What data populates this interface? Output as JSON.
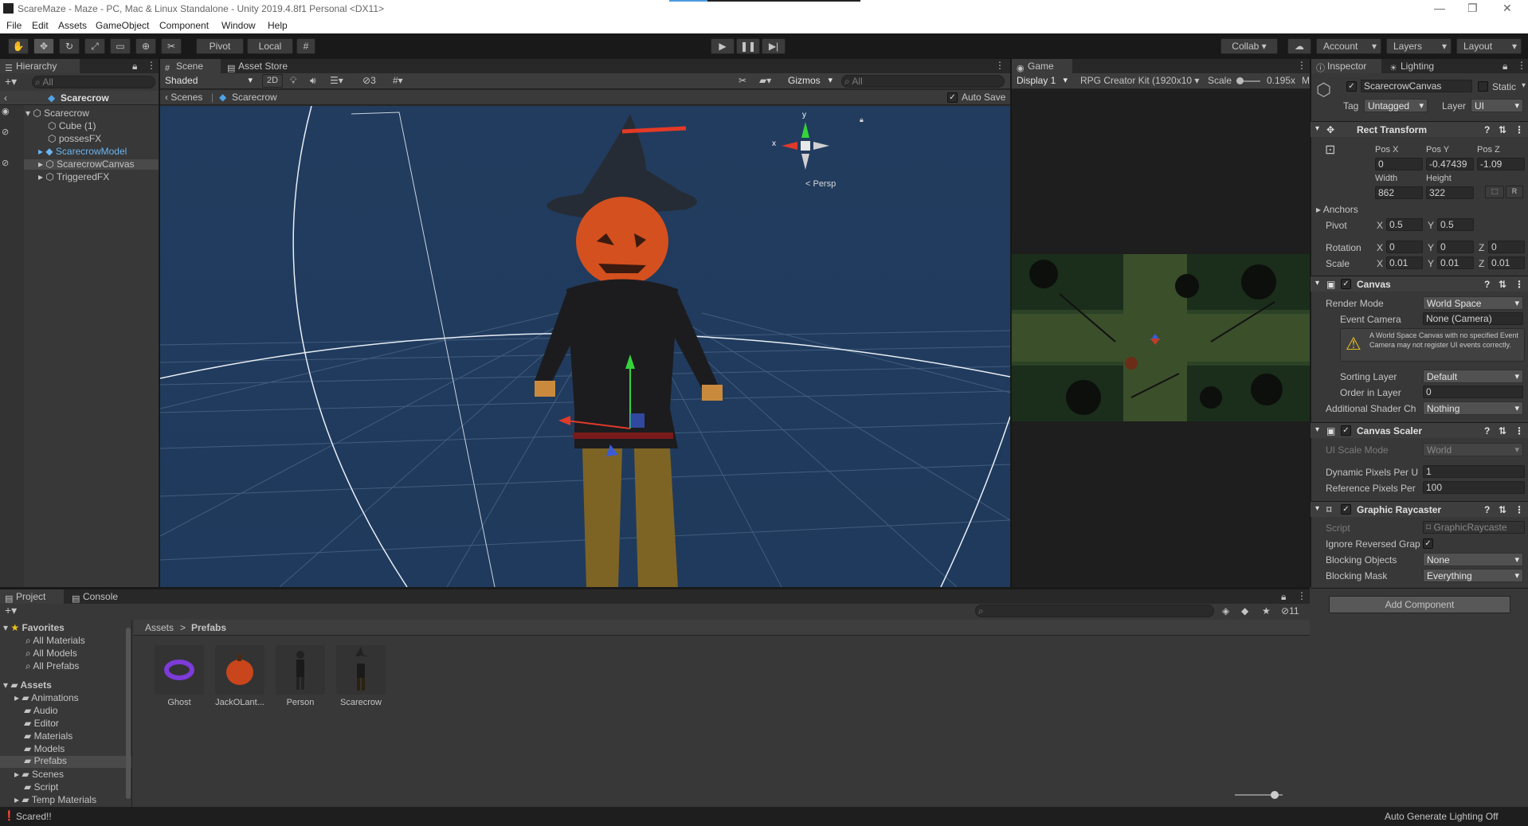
{
  "window": {
    "title": "ScareMaze - Maze - PC, Mac & Linux Standalone - Unity 2019.4.8f1 Personal <DX11>"
  },
  "menu": [
    "File",
    "Edit",
    "Assets",
    "GameObject",
    "Component",
    "Window",
    "Help"
  ],
  "toolbar": {
    "pivot": "Pivot",
    "local": "Local",
    "collab": "Collab ▾",
    "account": "Account",
    "layers": "Layers",
    "layout": "Layout"
  },
  "hierarchy": {
    "tab": "Hierarchy",
    "search_placeholder": "All",
    "scene": "Scarecrow",
    "items": [
      {
        "label": "Scarecrow",
        "selected": false
      },
      {
        "label": "Cube (1)",
        "selected": false
      },
      {
        "label": "possesFX",
        "selected": false
      },
      {
        "label": "ScarecrowModel",
        "selected": false
      },
      {
        "label": "ScarecrowCanvas",
        "selected": true
      },
      {
        "label": "TriggeredFX",
        "selected": false
      }
    ]
  },
  "scene": {
    "tabs": [
      "Scene",
      "Asset Store"
    ],
    "shading": "Shaded",
    "mode2d": "2D",
    "hidden_count": "3",
    "gizmos": "Gizmos",
    "search_placeholder": "All",
    "breadcrumb_root": "Scenes",
    "breadcrumb_item": "Scarecrow",
    "auto_save": "Auto Save",
    "persp": "< Persp",
    "axis_x": "x",
    "axis_y": "y"
  },
  "game": {
    "tab": "Game",
    "display": "Display 1",
    "resolution": "RPG Creator Kit (1920x10 ▾",
    "scale_label": "Scale",
    "scale_value": "0.195x",
    "more": "M"
  },
  "inspector": {
    "tabs": [
      "Inspector",
      "Lighting"
    ],
    "object_name": "ScarecrowCanvas",
    "static": "Static",
    "tag_label": "Tag",
    "tag": "Untagged",
    "layer_label": "Layer",
    "layer": "UI",
    "rect_transform": {
      "title": "Rect Transform",
      "pos_x_label": "Pos X",
      "pos_y_label": "Pos Y",
      "pos_z_label": "Pos Z",
      "pos_x": "0",
      "pos_y": "-0.47439",
      "pos_z": "-1.09",
      "width_label": "Width",
      "height_label": "Height",
      "width": "862",
      "height": "322",
      "anchors": "Anchors",
      "pivot": "Pivot",
      "pivot_x": "0.5",
      "pivot_y": "0.5",
      "rotation": "Rotation",
      "rot_x": "0",
      "rot_y": "0",
      "rot_z": "0",
      "scale": "Scale",
      "scale_x": "0.01",
      "scale_y": "0.01",
      "scale_z": "0.01"
    },
    "canvas": {
      "title": "Canvas",
      "render_mode_label": "Render Mode",
      "render_mode": "World Space",
      "event_camera_label": "Event Camera",
      "event_camera": "None (Camera)",
      "warning": "A World Space Canvas with no specified Event Camera may not register UI events correctly.",
      "sorting_layer_label": "Sorting Layer",
      "sorting_layer": "Default",
      "order_label": "Order in Layer",
      "order": "0",
      "shader_label": "Additional Shader Ch",
      "shader": "Nothing"
    },
    "canvas_scaler": {
      "title": "Canvas Scaler",
      "scale_mode_label": "UI Scale Mode",
      "scale_mode": "World",
      "dyn_label": "Dynamic Pixels Per U",
      "dyn": "1",
      "ref_label": "Reference Pixels Per",
      "ref": "100"
    },
    "raycaster": {
      "title": "Graphic Raycaster",
      "script_label": "Script",
      "script": "GraphicRaycaste",
      "ignore_label": "Ignore Reversed Grap",
      "blocking_objects_label": "Blocking Objects",
      "blocking_objects": "None",
      "blocking_mask_label": "Blocking Mask",
      "blocking_mask": "Everything"
    },
    "add_component": "Add Component"
  },
  "project": {
    "tabs": [
      "Project",
      "Console"
    ],
    "hidden_count": "11",
    "breadcrumb_root": "Assets",
    "breadcrumb_item": "Prefabs",
    "favorites_label": "Favorites",
    "favorites": [
      "All Materials",
      "All Models",
      "All Prefabs"
    ],
    "assets_label": "Assets",
    "folders": [
      "Animations",
      "Audio",
      "Editor",
      "Materials",
      "Models",
      "Prefabs",
      "Scenes",
      "Script",
      "Temp Materials"
    ],
    "grid": [
      {
        "name": "Ghost"
      },
      {
        "name": "JackOLant..."
      },
      {
        "name": "Person"
      },
      {
        "name": "Scarecrow"
      }
    ]
  },
  "statusbar": {
    "message": "Scared!!",
    "right": "Auto Generate Lighting Off"
  },
  "colors": {
    "scene_bg": "#213a5c",
    "selection": "#2c5d87",
    "accent": "#4b9be1"
  }
}
